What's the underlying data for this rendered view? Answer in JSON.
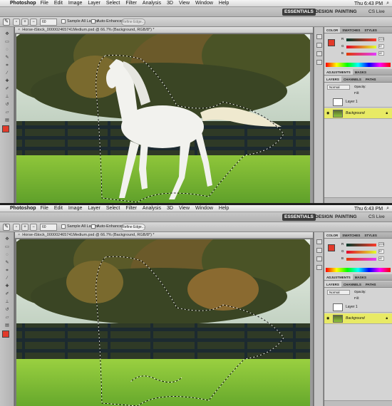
{
  "menubar": {
    "app": "Photoshop",
    "items": [
      "File",
      "Edit",
      "Image",
      "Layer",
      "Select",
      "Filter",
      "Analysis",
      "3D",
      "View",
      "Window",
      "Help"
    ],
    "clock": "Thu 6:43 PM"
  },
  "workspace": {
    "essentials": "ESSENTIALS",
    "design": "DESIGN",
    "painting": "PAINTING",
    "cs_live": "CS Live"
  },
  "options": {
    "brush_size": "60",
    "sample_all_layers": "Sample All Layers",
    "auto_enhance": "Auto-Enhance",
    "refine_edge": "Refine Edge..."
  },
  "document": {
    "tab_title": "Horse-iStock_000002465741Medium.psd @ 66.7% (Background, RGB/8*) *"
  },
  "panels": {
    "color_tabs": [
      "COLOR",
      "SWATCHES",
      "STYLES"
    ],
    "rgb_labels": [
      "R",
      "G",
      "B"
    ],
    "rgb_values": [
      "225",
      "57",
      "42"
    ],
    "adjust_tabs": [
      "ADJUSTMENTS",
      "MASKS"
    ],
    "layer_tabs": [
      "LAYERS",
      "CHANNELS",
      "PATHS"
    ],
    "blend_mode": "Normal",
    "opacity_label": "Opacity:",
    "fill_label": "Fill:",
    "layers": [
      {
        "name": "Layer 1"
      },
      {
        "name": "Background"
      }
    ]
  },
  "colors": {
    "foreground": "#e23a2a",
    "selected_layer": "#e8ea65"
  },
  "icons": [
    "apple-icon",
    "magnifier-icon",
    "lasso-icon",
    "quick-selection-icon",
    "eye-icon",
    "lock-icon"
  ]
}
